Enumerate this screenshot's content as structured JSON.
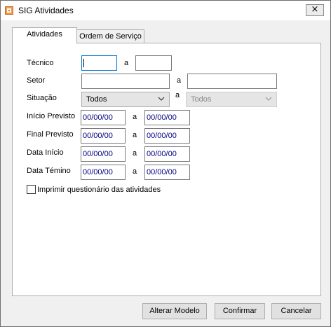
{
  "window": {
    "title": "SIG Atividades",
    "close": "×"
  },
  "tabs": [
    {
      "label": "Atividades"
    },
    {
      "label": "Ordem de Serviço"
    }
  ],
  "form": {
    "separator": "a",
    "tecnico_label": "Técnico",
    "setor_label": "Setor",
    "situacao_label": "Situação",
    "situacao_from": "Todos",
    "situacao_to": "Todos",
    "inicio_previsto_label": "Início Previsto",
    "final_previsto_label": "Final Previsto",
    "data_inicio_label": "Data Início",
    "data_termino_label": "Data Témino",
    "date_value": "00/00/00",
    "checkbox_label": "Imprimir questionário das atividades"
  },
  "buttons": {
    "alterar": "Alterar Modelo",
    "confirmar": "Confirmar",
    "cancelar": "Cancelar"
  }
}
